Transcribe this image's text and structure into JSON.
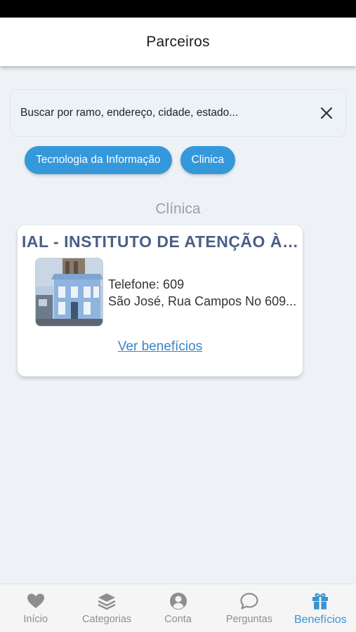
{
  "header": {
    "title": "Parceiros"
  },
  "search": {
    "placeholder": "Buscar por ramo, endereço, cidade, estado..."
  },
  "filters": [
    {
      "label": "Tecnologia da Informação"
    },
    {
      "label": "Clinica"
    }
  ],
  "section": {
    "title": "Clínica"
  },
  "partners": [
    {
      "name": "IAL - INSTITUTO DE ATENÇÃO À ...",
      "phone": "Telefone: 609",
      "address": "São José, Rua Campos No 609...",
      "link_label": "Ver benefícios"
    }
  ],
  "tabs": [
    {
      "label": "Início",
      "icon": "heart-icon"
    },
    {
      "label": "Categorias",
      "icon": "layers-icon"
    },
    {
      "label": "Conta",
      "icon": "user-circle-icon"
    },
    {
      "label": "Perguntas",
      "icon": "chat-bubble-icon"
    },
    {
      "label": "Benefícios",
      "icon": "gift-icon",
      "active": true
    }
  ],
  "colors": {
    "accent": "#3498db",
    "active_tab": "#3a93d2",
    "inactive_tab": "#8e8e8e",
    "partner_name": "#4a5f86",
    "background": "#eef2f6"
  }
}
